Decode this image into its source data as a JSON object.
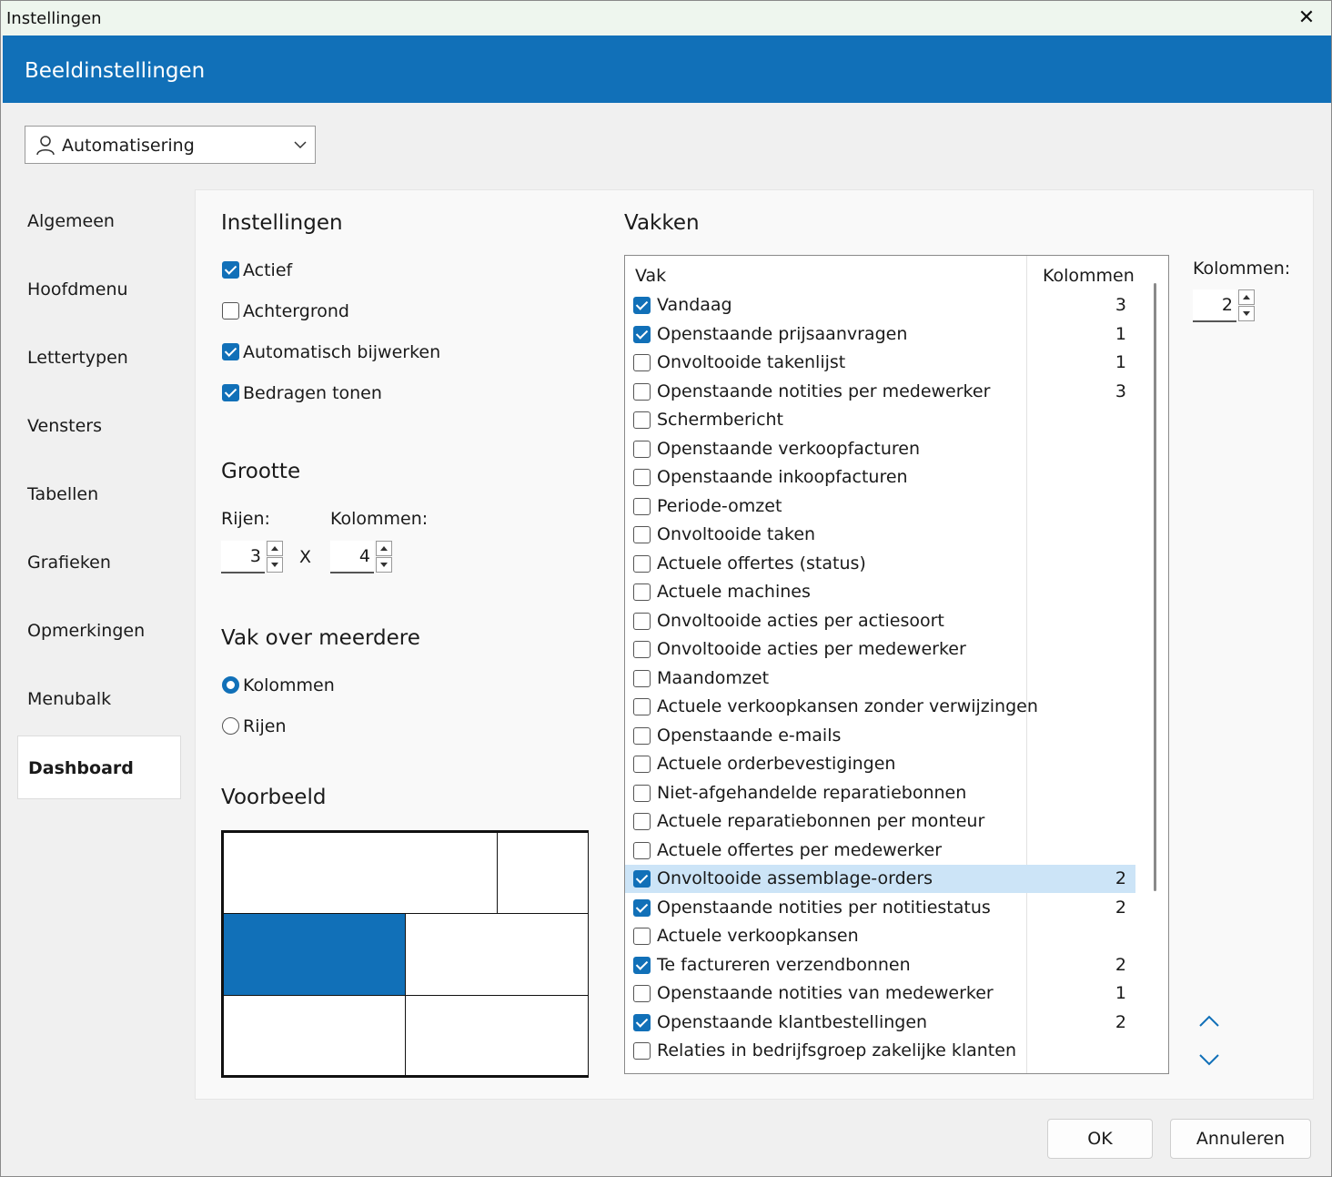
{
  "window": {
    "title": "Instellingen"
  },
  "banner": {
    "title": "Beeldinstellingen"
  },
  "user_select": {
    "value": "Automatisering"
  },
  "nav": {
    "items": [
      "Algemeen",
      "Hoofdmenu",
      "Lettertypen",
      "Vensters",
      "Tabellen",
      "Grafieken",
      "Opmerkingen",
      "Menubalk",
      "Dashboard"
    ],
    "active": "Dashboard"
  },
  "instellingen": {
    "heading": "Instellingen",
    "checkboxes": [
      {
        "label": "Actief",
        "checked": true
      },
      {
        "label": "Achtergrond",
        "checked": false
      },
      {
        "label": "Automatisch bijwerken",
        "checked": true
      },
      {
        "label": "Bedragen tonen",
        "checked": true
      }
    ]
  },
  "grootte": {
    "heading": "Grootte",
    "rows_label": "Rijen:",
    "rows_value": "3",
    "times": "X",
    "cols_label": "Kolommen:",
    "cols_value": "4"
  },
  "vak_over": {
    "heading": "Vak over meerdere",
    "options": [
      {
        "label": "Kolommen",
        "selected": true
      },
      {
        "label": "Rijen",
        "selected": false
      }
    ]
  },
  "voorbeeld": {
    "heading": "Voorbeeld"
  },
  "vakken": {
    "heading": "Vakken",
    "col_vak": "Vak",
    "col_kolommen": "Kolommen",
    "rows": [
      {
        "name": "Vandaag",
        "checked": true,
        "cols": "3"
      },
      {
        "name": "Openstaande prijsaanvragen",
        "checked": true,
        "cols": "1"
      },
      {
        "name": "Onvoltooide takenlijst",
        "checked": false,
        "cols": "1"
      },
      {
        "name": "Openstaande notities per medewerker",
        "checked": false,
        "cols": "3"
      },
      {
        "name": "Schermbericht",
        "checked": false,
        "cols": ""
      },
      {
        "name": "Openstaande verkoopfacturen",
        "checked": false,
        "cols": ""
      },
      {
        "name": "Openstaande inkoopfacturen",
        "checked": false,
        "cols": ""
      },
      {
        "name": "Periode-omzet",
        "checked": false,
        "cols": ""
      },
      {
        "name": "Onvoltooide taken",
        "checked": false,
        "cols": ""
      },
      {
        "name": "Actuele offertes (status)",
        "checked": false,
        "cols": ""
      },
      {
        "name": "Actuele machines",
        "checked": false,
        "cols": ""
      },
      {
        "name": "Onvoltooide acties per actiesoort",
        "checked": false,
        "cols": ""
      },
      {
        "name": "Onvoltooide acties per medewerker",
        "checked": false,
        "cols": ""
      },
      {
        "name": "Maandomzet",
        "checked": false,
        "cols": ""
      },
      {
        "name": "Actuele verkoopkansen zonder verwijzingen",
        "checked": false,
        "cols": ""
      },
      {
        "name": "Openstaande e-mails",
        "checked": false,
        "cols": ""
      },
      {
        "name": "Actuele orderbevestigingen",
        "checked": false,
        "cols": ""
      },
      {
        "name": "Niet-afgehandelde reparatiebonnen",
        "checked": false,
        "cols": ""
      },
      {
        "name": "Actuele reparatiebonnen per monteur",
        "checked": false,
        "cols": ""
      },
      {
        "name": "Actuele offertes per medewerker",
        "checked": false,
        "cols": ""
      },
      {
        "name": "Onvoltooide assemblage-orders",
        "checked": true,
        "cols": "2",
        "highlighted": true
      },
      {
        "name": "Openstaande notities per notitiestatus",
        "checked": true,
        "cols": "2"
      },
      {
        "name": "Actuele verkoopkansen",
        "checked": false,
        "cols": ""
      },
      {
        "name": "Te factureren verzendbonnen",
        "checked": true,
        "cols": "2"
      },
      {
        "name": "Openstaande notities van medewerker",
        "checked": false,
        "cols": "1"
      },
      {
        "name": "Openstaande klantbestellingen",
        "checked": true,
        "cols": "2"
      },
      {
        "name": "Relaties in bedrijfsgroep zakelijke klanten",
        "checked": false,
        "cols": ""
      }
    ]
  },
  "right_kolommen": {
    "label": "Kolommen:",
    "value": "2"
  },
  "buttons": {
    "ok": "OK",
    "cancel": "Annuleren"
  },
  "colors": {
    "accent": "#1170b8",
    "highlight": "#cce4f7",
    "titlebar": "#eef6ee"
  }
}
